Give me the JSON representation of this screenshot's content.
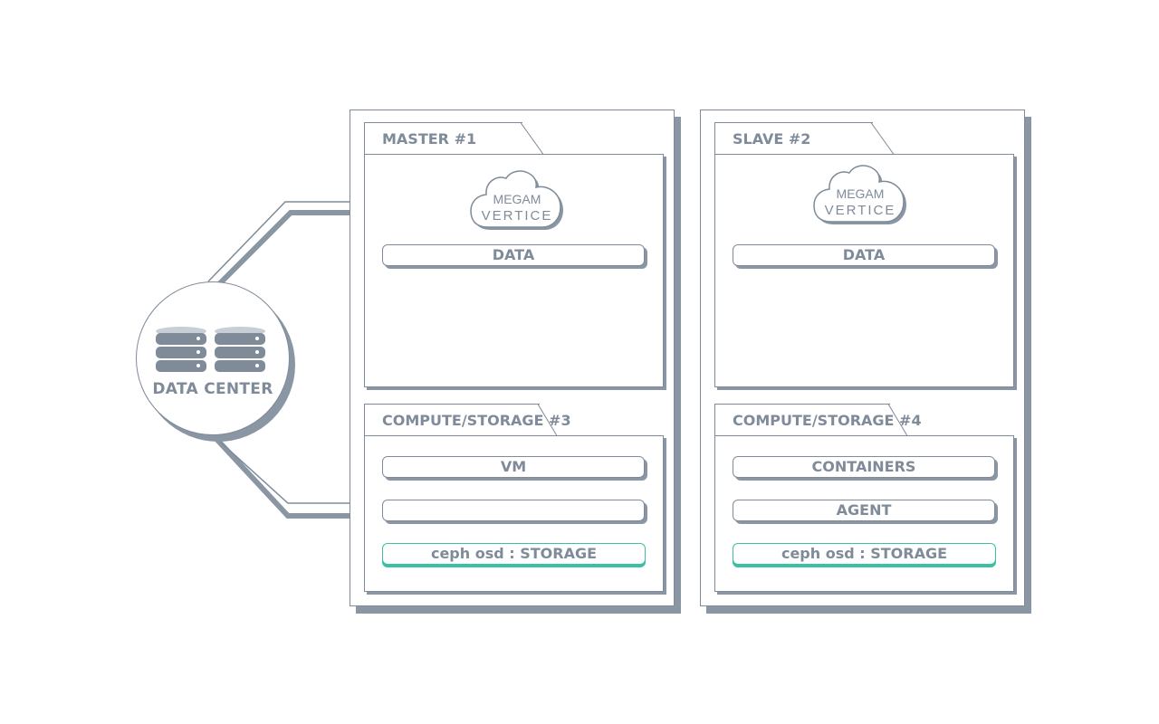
{
  "data_center": {
    "label": "DATA CENTER",
    "icon": "database-icon"
  },
  "nodes": [
    {
      "title": "MASTER #1",
      "top_items": [
        "DATA"
      ],
      "cloud": {
        "line1": "MEGAM",
        "line2": "VERTICE"
      },
      "compute_title": "COMPUTE/STORAGE #3",
      "compute_items": [
        "VM",
        ""
      ],
      "storage": "ceph osd : STORAGE"
    },
    {
      "title": "SLAVE #2",
      "top_items": [
        "DATA"
      ],
      "cloud": {
        "line1": "MEGAM",
        "line2": "VERTICE"
      },
      "compute_title": "COMPUTE/STORAGE #4",
      "compute_items": [
        "CONTAINERS",
        "AGENT"
      ],
      "storage": "ceph osd : STORAGE"
    }
  ],
  "colors": {
    "line": "#7f8b99",
    "shadow": "#8a96a3",
    "accent": "#3dbfa3"
  }
}
